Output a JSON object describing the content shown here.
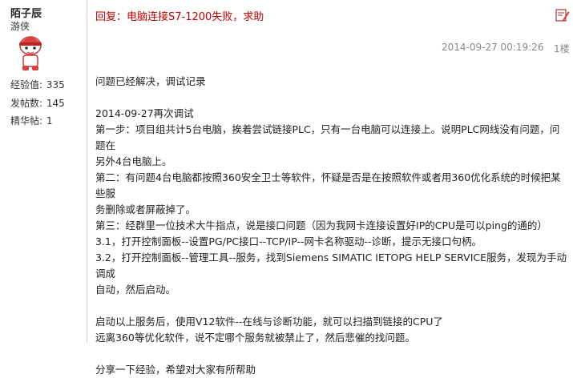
{
  "user": {
    "name": "陌子辰",
    "rank": "游侠",
    "stats": [
      {
        "label": "经验值:",
        "value": "335"
      },
      {
        "label": "发帖数:",
        "value": "145"
      },
      {
        "label": "精华帖:",
        "value": "1"
      }
    ]
  },
  "post": {
    "title": "回复：电脑连接S7-1200失败，求助",
    "date": "2014-09-27 00:19:26",
    "floor": "1楼",
    "lines": [
      "问题已经解决，调试记录",
      "",
      "2014-09-27再次调试",
      "第一步：项目组共计5台电脑，挨着尝试链接PLC，只有一台电脑可以连接上。说明PLC网线没有问题，问题在",
      "另外4台电脑上。",
      "第二：有问题4台电脑都按照360安全卫士等软件，怀疑是否是在按照软件或者用360优化系统的时候把某些服",
      "务删除或者屏蔽掉了。",
      "第三：经群里一位技术大牛指点，说是接口问题（因为我网卡连接设置好IP的CPU是可以ping的通的）",
      "3.1，打开控制面板--设置PG/PC接口--TCP/IP--网卡名称驱动--诊断，提示无接口句柄。",
      "3.2，打开控制面板--管理工具--服务，找到Siemens SIMATIC IETOPG HELP SERVICE服务，发现为手动调成",
      "自动，然后启动。",
      "",
      "启动以上服务后，使用V12软件--在线与诊断功能，就可以扫描到链接的CPU了",
      "远离360等优化软件，说不定哪个服务就被禁止了，然后悲催的找问题。",
      "",
      "分享一下经验，希望对大家有所帮助"
    ]
  }
}
